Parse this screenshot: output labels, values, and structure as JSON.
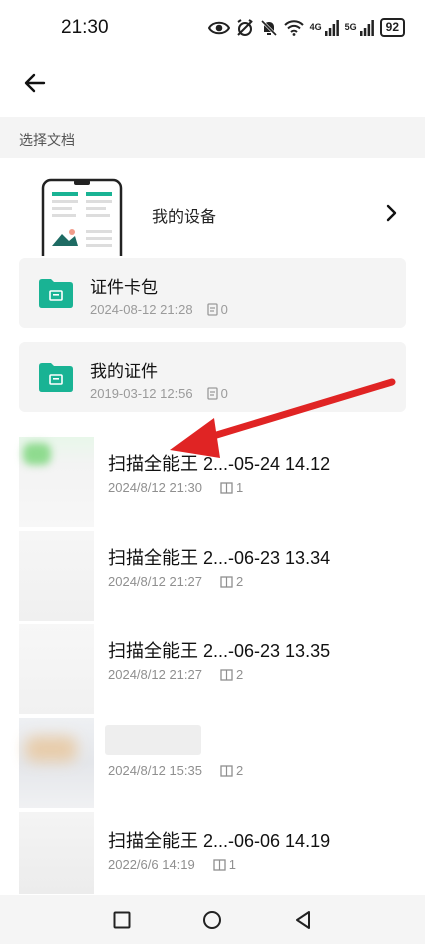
{
  "status_bar": {
    "time": "21:30",
    "network_4g": "4G",
    "network_5g": "5G",
    "battery": "92",
    "icons": [
      "eye-icon",
      "alarm-off-icon",
      "bell-off-icon",
      "wifi-icon",
      "signal-icon",
      "signal-icon",
      "battery-icon"
    ]
  },
  "header": {
    "back_icon": "arrow-left-icon",
    "section_label": "选择文档"
  },
  "device": {
    "label": "我的设备",
    "chevron_icon": "chevron-right-icon"
  },
  "folders": [
    {
      "title": "证件卡包",
      "date": "2024-08-12 21:28",
      "count": "0"
    },
    {
      "title": "我的证件",
      "date": "2019-03-12 12:56",
      "count": "0"
    }
  ],
  "documents": [
    {
      "title": "扫描全能王 2...-05-24 14.12",
      "date": "2024/8/12 21:30",
      "pages": "1"
    },
    {
      "title": "扫描全能王 2...-06-23 13.34",
      "date": "2024/8/12 21:27",
      "pages": "2"
    },
    {
      "title": "扫描全能王 2...-06-23 13.35",
      "date": "2024/8/12 21:27",
      "pages": "2"
    },
    {
      "title": "",
      "date": "2024/8/12 15:35",
      "pages": "2"
    },
    {
      "title": "扫描全能王 2...-06-06 14.19",
      "date": "2022/6/6 14:19",
      "pages": "1"
    }
  ],
  "nav": {
    "icons": [
      "square-icon",
      "circle-icon",
      "triangle-back-icon"
    ]
  },
  "annotation_color": "#e02424",
  "accent_color": "#19b394"
}
